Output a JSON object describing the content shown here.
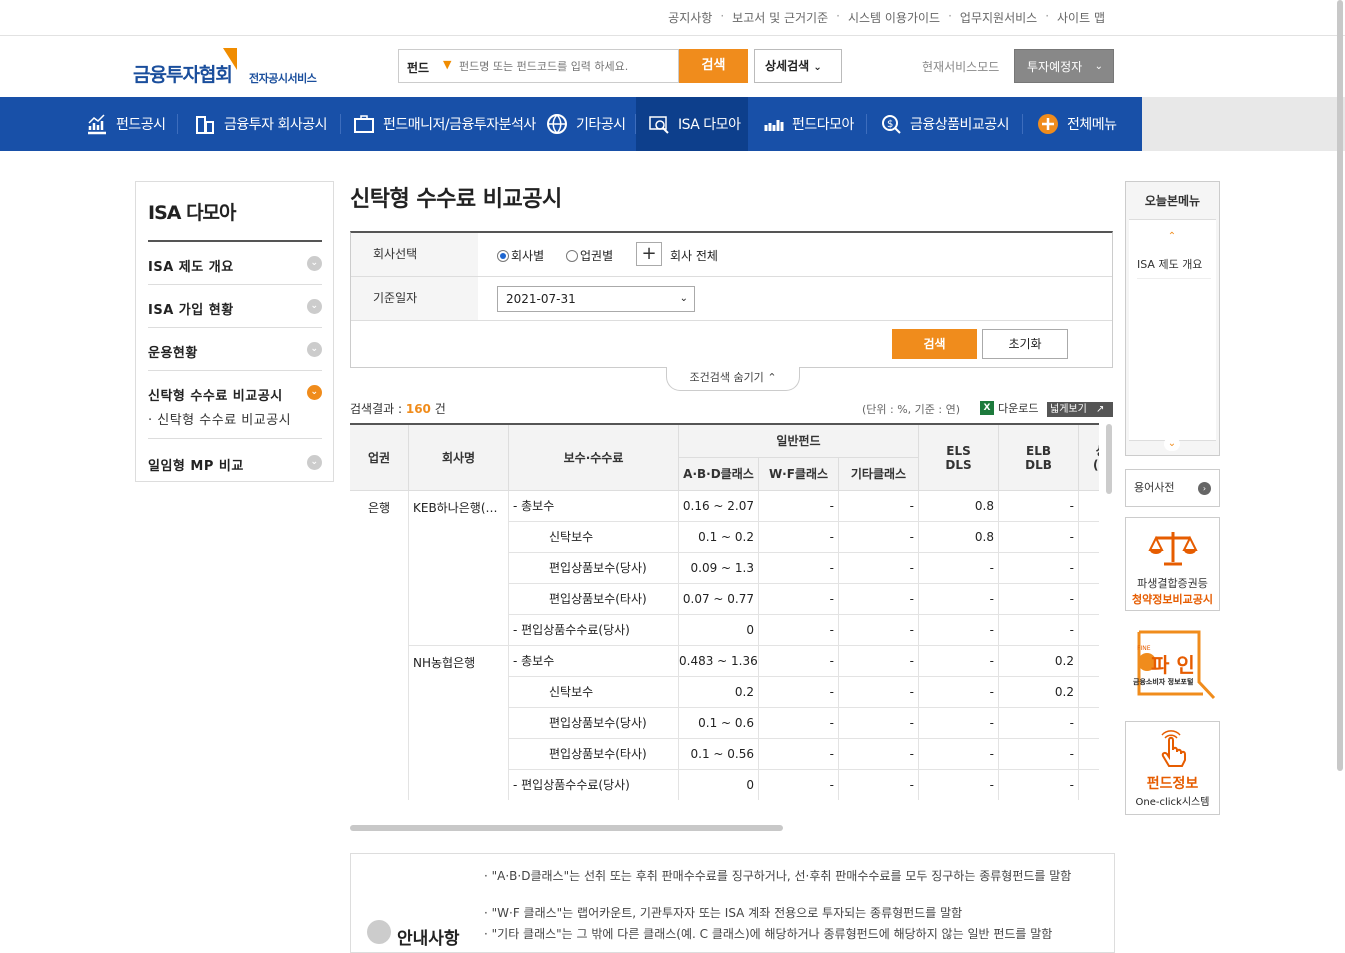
{
  "util_links": [
    "공지사항",
    "보고서 및 근거기준",
    "시스템 이용가이드",
    "업무지원서비스",
    "사이트 맵"
  ],
  "header": {
    "logo_main": "금융투자협회",
    "logo_sub": "전자공시서비스",
    "search_category": "펀드",
    "search_placeholder": "펀드명 또는 펀드코드를 입력 하세요.",
    "search_button": "검색",
    "advanced_button": "상세검색",
    "service_mode_label": "현재서비스모드",
    "service_mode_value": "투자예정자"
  },
  "gnb": [
    "펀드공시",
    "금융투자 회사공시",
    "펀드매니저/금융투자분석사",
    "기타공시",
    "ISA 다모아",
    "펀드다모아",
    "금융상품비교공시",
    "전체메뉴"
  ],
  "lnb": {
    "title": "ISA 다모아",
    "items": [
      "ISA 제도 개요",
      "ISA 가입 현황",
      "운용현황",
      "신탁형 수수료 비교공시",
      "일임형 MP 비교"
    ],
    "sub_item": "· 신탁형 수수료 비교공시"
  },
  "page_title": "신탁형 수수료 비교공시",
  "conditions": {
    "company_label": "회사선택",
    "radio_company": "회사별",
    "radio_sector": "업권별",
    "all_companies": "회사 전체",
    "date_label": "기준일자",
    "date_value": "2021-07-31",
    "search_button": "검색",
    "reset_button": "초기화",
    "fold_label": "조건검색 숨기기"
  },
  "result": {
    "label": "검색결과 :",
    "count": "160",
    "unit_suffix": "건",
    "unit_note": "(단위 : %, 기준 : 연)",
    "download": "다운로드",
    "wide_view": "넓게보기"
  },
  "table": {
    "headers": {
      "sector": "업권",
      "company": "회사명",
      "fee": "보수·수수료",
      "general_fund": "일반펀드",
      "abd": "A·B·D클래스",
      "wf": "W·F클래스",
      "other": "기타클래스",
      "els": "ELS DLS",
      "elb": "ELB DLB",
      "extra": "상 (비"
    },
    "sector_value": "은행",
    "groups": [
      {
        "company": "KEB하나은행(…",
        "rows": [
          {
            "fee": "- 총보수",
            "indent": false,
            "abd": "0.16 ~ 2.07",
            "wf": "-",
            "other": "-",
            "els": "0.8",
            "elb": "-"
          },
          {
            "fee": "신탁보수",
            "indent": true,
            "abd": "0.1 ~ 0.2",
            "wf": "-",
            "other": "-",
            "els": "0.8",
            "elb": "-"
          },
          {
            "fee": "편입상품보수(당사)",
            "indent": true,
            "abd": "0.09 ~ 1.3",
            "wf": "-",
            "other": "-",
            "els": "-",
            "elb": "-"
          },
          {
            "fee": "편입상품보수(타사)",
            "indent": true,
            "abd": "0.07 ~ 0.77",
            "wf": "-",
            "other": "-",
            "els": "-",
            "elb": "-"
          },
          {
            "fee": "- 편입상품수수료(당사)",
            "indent": false,
            "abd": "0",
            "wf": "-",
            "other": "-",
            "els": "-",
            "elb": "-"
          }
        ]
      },
      {
        "company": "NH농협은행",
        "rows": [
          {
            "fee": "- 총보수",
            "indent": false,
            "abd": "0.483 ~ 1.36",
            "wf": "-",
            "other": "-",
            "els": "-",
            "elb": "0.2"
          },
          {
            "fee": "신탁보수",
            "indent": true,
            "abd": "0.2",
            "wf": "-",
            "other": "-",
            "els": "-",
            "elb": "0.2"
          },
          {
            "fee": "편입상품보수(당사)",
            "indent": true,
            "abd": "0.1 ~ 0.6",
            "wf": "-",
            "other": "-",
            "els": "-",
            "elb": "-"
          },
          {
            "fee": "편입상품보수(타사)",
            "indent": true,
            "abd": "0.1 ~ 0.56",
            "wf": "-",
            "other": "-",
            "els": "-",
            "elb": "-"
          },
          {
            "fee": "- 편입상품수수료(당사)",
            "indent": false,
            "abd": "0",
            "wf": "-",
            "other": "-",
            "els": "-",
            "elb": "-"
          }
        ]
      }
    ]
  },
  "info": {
    "title": "안내사항",
    "lines": [
      "· \"A·B·D클래스\"는 선취 또는 후취 판매수수료를 징구하거나, 선·후취 판매수수료를 모두 징구하는 종류형펀드를 말함",
      "· \"W·F 클래스\"는 랩어카운트, 기관투자자 또는 ISA 계좌 전용으로 투자되는 종류형펀드를 말함",
      "· \"기타 클래스\"는 그 밖에 다른 클래스(예. C 클래스)에 해당하거나 종류형펀드에 해당하지 않는 일반 펀드를 말함"
    ]
  },
  "right": {
    "today_title": "오늘본메뉴",
    "today_items": [
      "ISA 제도 개요"
    ],
    "dictionary": "용어사전",
    "banner1_line1": "파생결합증권등",
    "banner1_line2": "청약정보비교공시",
    "banner2_main": "파 인",
    "banner2_sub": "금융소비자 정보포털",
    "banner2_tag": "FINE",
    "banner3_line1": "펀드정보",
    "banner3_line2": "One-click시스템"
  },
  "colors": {
    "brand_blue": "#1850a8",
    "accent_orange": "#f08c1c"
  }
}
